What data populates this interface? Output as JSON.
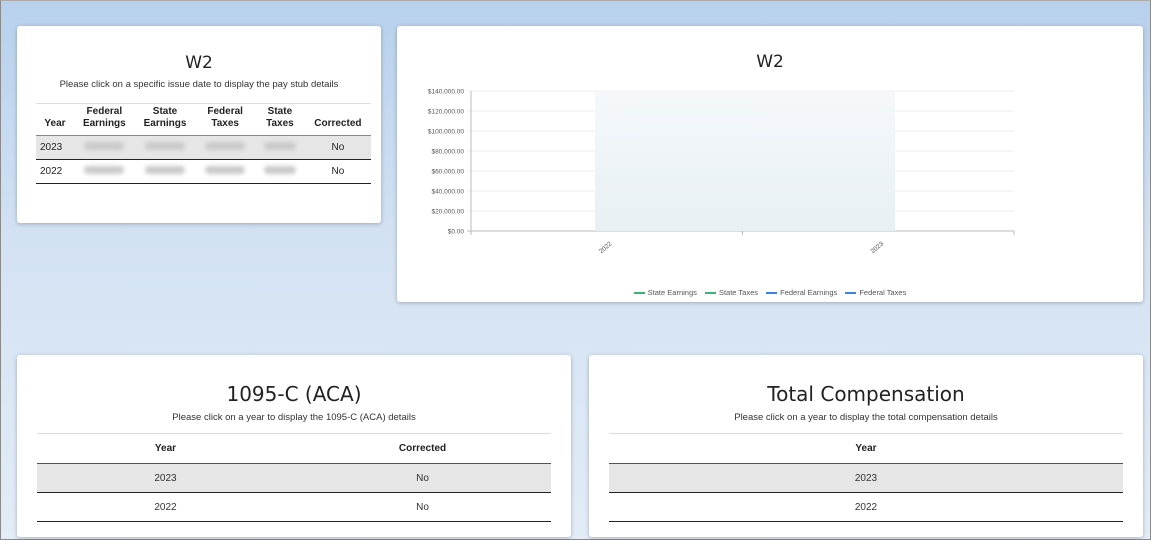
{
  "w2_table_card": {
    "title": "W2",
    "subtitle": "Please click on a specific issue date to display the pay stub details",
    "headers": [
      {
        "line1": "",
        "line2": "Year"
      },
      {
        "line1": "Federal",
        "line2": "Earnings"
      },
      {
        "line1": "State",
        "line2": "Earnings"
      },
      {
        "line1": "Federal",
        "line2": "Taxes"
      },
      {
        "line1": "State",
        "line2": "Taxes"
      },
      {
        "line1": "",
        "line2": "Corrected"
      }
    ],
    "rows": [
      {
        "year": "2023",
        "corrected": "No"
      },
      {
        "year": "2022",
        "corrected": "No"
      }
    ]
  },
  "w2_chart_card": {
    "title": "W2"
  },
  "chart_data": {
    "type": "line",
    "title": "W2",
    "categories": [
      "2022",
      "2023"
    ],
    "y_tick_labels": [
      "$0.00",
      "$20,000.00",
      "$40,000.00",
      "$60,000.00",
      "$80,000.00",
      "$100,000.00",
      "$120,000.00",
      "$140,000.00"
    ],
    "ylim": [
      0,
      140000
    ],
    "grid": true,
    "legend_position": "bottom",
    "series": [
      {
        "name": "State Earnings",
        "color": "#3cb371",
        "values": []
      },
      {
        "name": "State Taxes",
        "color": "#3cb371",
        "values": []
      },
      {
        "name": "Federal Earnings",
        "color": "#3b82e6",
        "values": []
      },
      {
        "name": "Federal Taxes",
        "color": "#3b82e6",
        "values": []
      }
    ]
  },
  "aca_card": {
    "title": "1095-C (ACA)",
    "subtitle": "Please click on a year to display the 1095-C (ACA) details",
    "headers": [
      "Year",
      "Corrected"
    ],
    "rows": [
      {
        "year": "2023",
        "corrected": "No"
      },
      {
        "year": "2022",
        "corrected": "No"
      }
    ]
  },
  "total_comp_card": {
    "title": "Total Compensation",
    "subtitle": "Please click on a year to display the total compensation details",
    "headers": [
      "Year"
    ],
    "rows": [
      {
        "year": "2023"
      },
      {
        "year": "2022"
      }
    ]
  }
}
